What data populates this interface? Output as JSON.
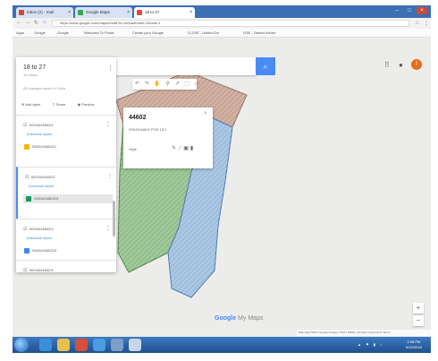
{
  "browser": {
    "tabs": [
      {
        "label": "Inbox (2) - mail",
        "color": "#d44638"
      },
      {
        "label": "Google Maps",
        "color": "#34a853"
      },
      {
        "label": "18 to 27",
        "color": "#e8453c"
      }
    ],
    "url": "https://www.google.com/maps/d/edit?hl=en&authuser=0&mid=1",
    "bookmarks": [
      "Apps",
      "Google",
      "Google",
      "Welcome To Portal",
      "Create your Google",
      "G-DSE - Unified Dir",
      "DSE - District Inform"
    ]
  },
  "map": {
    "search_placeholder": "",
    "toolstrip": "↶ ↷ ✋ ⚲ ↗ ⬚ ▭",
    "logo_google": "Google",
    "logo_mymaps": "My Maps",
    "zoom_in": "+",
    "zoom_out": "−",
    "attribution": "Map data ©2017 Google Imagery ©2017 DNES, Landsat / Copernicus Terms",
    "avatar_letter": "I",
    "colors": {
      "brown": "#c9a697",
      "green": "#93c08d",
      "blue": "#9fbfde"
    }
  },
  "popup": {
    "title": "44602",
    "subtitle": "S0043/44602 POS 1/21",
    "style": "Style"
  },
  "panel": {
    "title": "18 to 27",
    "subtitle": "18 views",
    "note": "All changes saved in Drive",
    "actions": [
      "Add layer",
      "Share",
      "Preview"
    ],
    "layers": [
      {
        "name": "S0034/44602/1",
        "style": "Individual styles",
        "item": "S0034/44602/1",
        "swatch": "#f4b400",
        "selected": false
      },
      {
        "name": "S0034/44602/2",
        "style": "Individual styles",
        "item": "S0034/44602/3",
        "swatch": "#0f9d58",
        "selected": true
      },
      {
        "name": "S0034/44602/3",
        "style": "Individual styles",
        "item": "S0034/44602/3",
        "swatch": "#4285f4",
        "selected": false
      },
      {
        "name": "S0034/44602/4",
        "style": "",
        "item": "",
        "swatch": "",
        "selected": false
      }
    ]
  },
  "taskbar": {
    "clock_time": "2:08 PM",
    "clock_date": "6/22/2016"
  }
}
